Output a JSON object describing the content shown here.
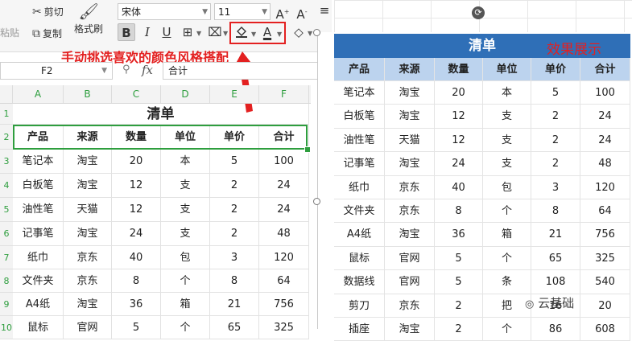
{
  "ribbon": {
    "paste_label": "粘贴",
    "cut_label": "剪切",
    "copy_label": "复制",
    "format_painter_label": "格式刷",
    "font_name": "宋体",
    "font_size": "11",
    "bold": "B",
    "italic": "I",
    "underline": "U",
    "font_color_glyph": "A"
  },
  "annotation": {
    "text": "手动挑选喜欢的颜色风格搭配",
    "color": "#e32020"
  },
  "formula_bar": {
    "cell_ref": "F2",
    "fx": "fx",
    "value": "合计"
  },
  "sheet": {
    "columns": [
      "A",
      "B",
      "C",
      "D",
      "E",
      "F"
    ],
    "row_numbers": [
      "1",
      "2",
      "3",
      "4",
      "5",
      "6",
      "7",
      "8",
      "9",
      "10"
    ],
    "title": "清单",
    "headers": [
      "产品",
      "来源",
      "数量",
      "单位",
      "单价",
      "合计"
    ],
    "rows": [
      [
        "笔记本",
        "淘宝",
        "20",
        "本",
        "5",
        "100"
      ],
      [
        "白板笔",
        "淘宝",
        "12",
        "支",
        "2",
        "24"
      ],
      [
        "油性笔",
        "天猫",
        "12",
        "支",
        "2",
        "24"
      ],
      [
        "记事笔",
        "淘宝",
        "24",
        "支",
        "2",
        "48"
      ],
      [
        "纸巾",
        "京东",
        "40",
        "包",
        "3",
        "120"
      ],
      [
        "文件夹",
        "京东",
        "8",
        "个",
        "8",
        "64"
      ],
      [
        "A4纸",
        "淘宝",
        "36",
        "箱",
        "21",
        "756"
      ],
      [
        "鼠标",
        "官网",
        "5",
        "个",
        "65",
        "325"
      ]
    ]
  },
  "preview": {
    "title": "清单",
    "badge": "效果展示",
    "title_bg": "#2f6fb7",
    "header_bg": "#bcd3ee",
    "headers": [
      "产品",
      "来源",
      "数量",
      "单位",
      "单价",
      "合计"
    ],
    "rows": [
      [
        "笔记本",
        "淘宝",
        "20",
        "本",
        "5",
        "100"
      ],
      [
        "白板笔",
        "淘宝",
        "12",
        "支",
        "2",
        "24"
      ],
      [
        "油性笔",
        "天猫",
        "12",
        "支",
        "2",
        "24"
      ],
      [
        "记事笔",
        "淘宝",
        "24",
        "支",
        "2",
        "48"
      ],
      [
        "纸巾",
        "京东",
        "40",
        "包",
        "3",
        "120"
      ],
      [
        "文件夹",
        "京东",
        "8",
        "个",
        "8",
        "64"
      ],
      [
        "A4纸",
        "淘宝",
        "36",
        "箱",
        "21",
        "756"
      ],
      [
        "鼠标",
        "官网",
        "5",
        "个",
        "65",
        "325"
      ],
      [
        "数据线",
        "官网",
        "5",
        "条",
        "108",
        "540"
      ],
      [
        "剪刀",
        "京东",
        "2",
        "把",
        "16",
        "20"
      ],
      [
        "插座",
        "淘宝",
        "2",
        "个",
        "86",
        "608"
      ]
    ]
  },
  "watermark": "云基础"
}
